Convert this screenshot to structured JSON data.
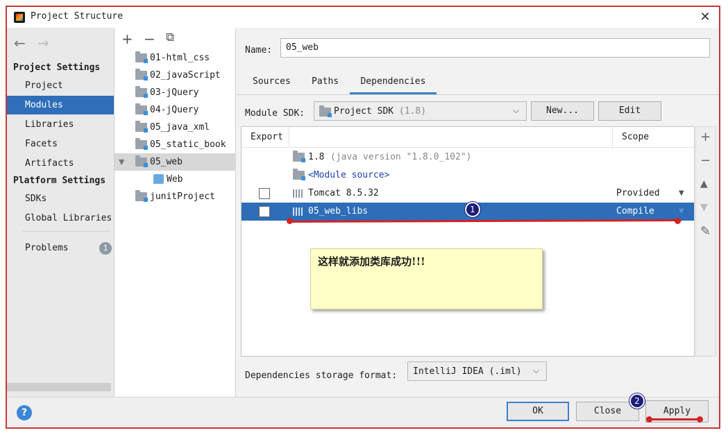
{
  "window": {
    "title": "Project Structure"
  },
  "nav": {
    "back": "←",
    "forward": "→",
    "project_settings": "Project Settings",
    "items_project": [
      {
        "label": "Project"
      },
      {
        "label": "Modules"
      },
      {
        "label": "Libraries"
      },
      {
        "label": "Facets"
      },
      {
        "label": "Artifacts"
      }
    ],
    "platform_settings": "Platform Settings",
    "items_platform": [
      {
        "label": "SDKs"
      },
      {
        "label": "Global Libraries"
      }
    ],
    "problems": "Problems",
    "problems_count": "1",
    "selected": "Modules"
  },
  "tree": {
    "add": "+",
    "remove": "−",
    "copy": "⧉",
    "items": [
      {
        "label": "01-html_css"
      },
      {
        "label": "02_javaScript"
      },
      {
        "label": "03-jQuery"
      },
      {
        "label": "04-jQuery"
      },
      {
        "label": "05_java_xml"
      },
      {
        "label": "05_static_book"
      },
      {
        "label": "05_web"
      },
      {
        "label": "Web"
      },
      {
        "label": "junitProject"
      }
    ],
    "selected": "05_web"
  },
  "module": {
    "name_label": "Name:",
    "name_value": "05_web",
    "tabs": [
      {
        "label": "Sources"
      },
      {
        "label": "Paths"
      },
      {
        "label": "Dependencies"
      }
    ],
    "active_tab": "Dependencies",
    "sdk_label": "Module SDK:",
    "sdk_value": "Project SDK",
    "sdk_version": "(1.8)",
    "new_button": "New...",
    "edit_button": "Edit",
    "deps_header": {
      "export": "Export",
      "scope": "Scope"
    },
    "deps": [
      {
        "name": "1.8",
        "detail": "(java version \"1.8.0_102\")",
        "scope": ""
      },
      {
        "name": "<Module source>",
        "detail": "",
        "scope": ""
      },
      {
        "name": "Tomcat 8.5.32",
        "detail": "",
        "scope": "Provided"
      },
      {
        "name": "05_web_libs",
        "detail": "",
        "scope": "Compile"
      }
    ],
    "side_tools": [
      "+",
      "−",
      "▲",
      "▼",
      "✎"
    ],
    "storage_label": "Dependencies storage format:",
    "storage_value": "IntelliJ IDEA (.iml)"
  },
  "annotations": {
    "note_text": "这样就添加类库成功!!!",
    "marker_1": "1",
    "marker_2": "2",
    "accent_color": "#d42222"
  },
  "footer": {
    "help": "?",
    "ok": "OK",
    "close": "Close",
    "apply": "Apply"
  }
}
